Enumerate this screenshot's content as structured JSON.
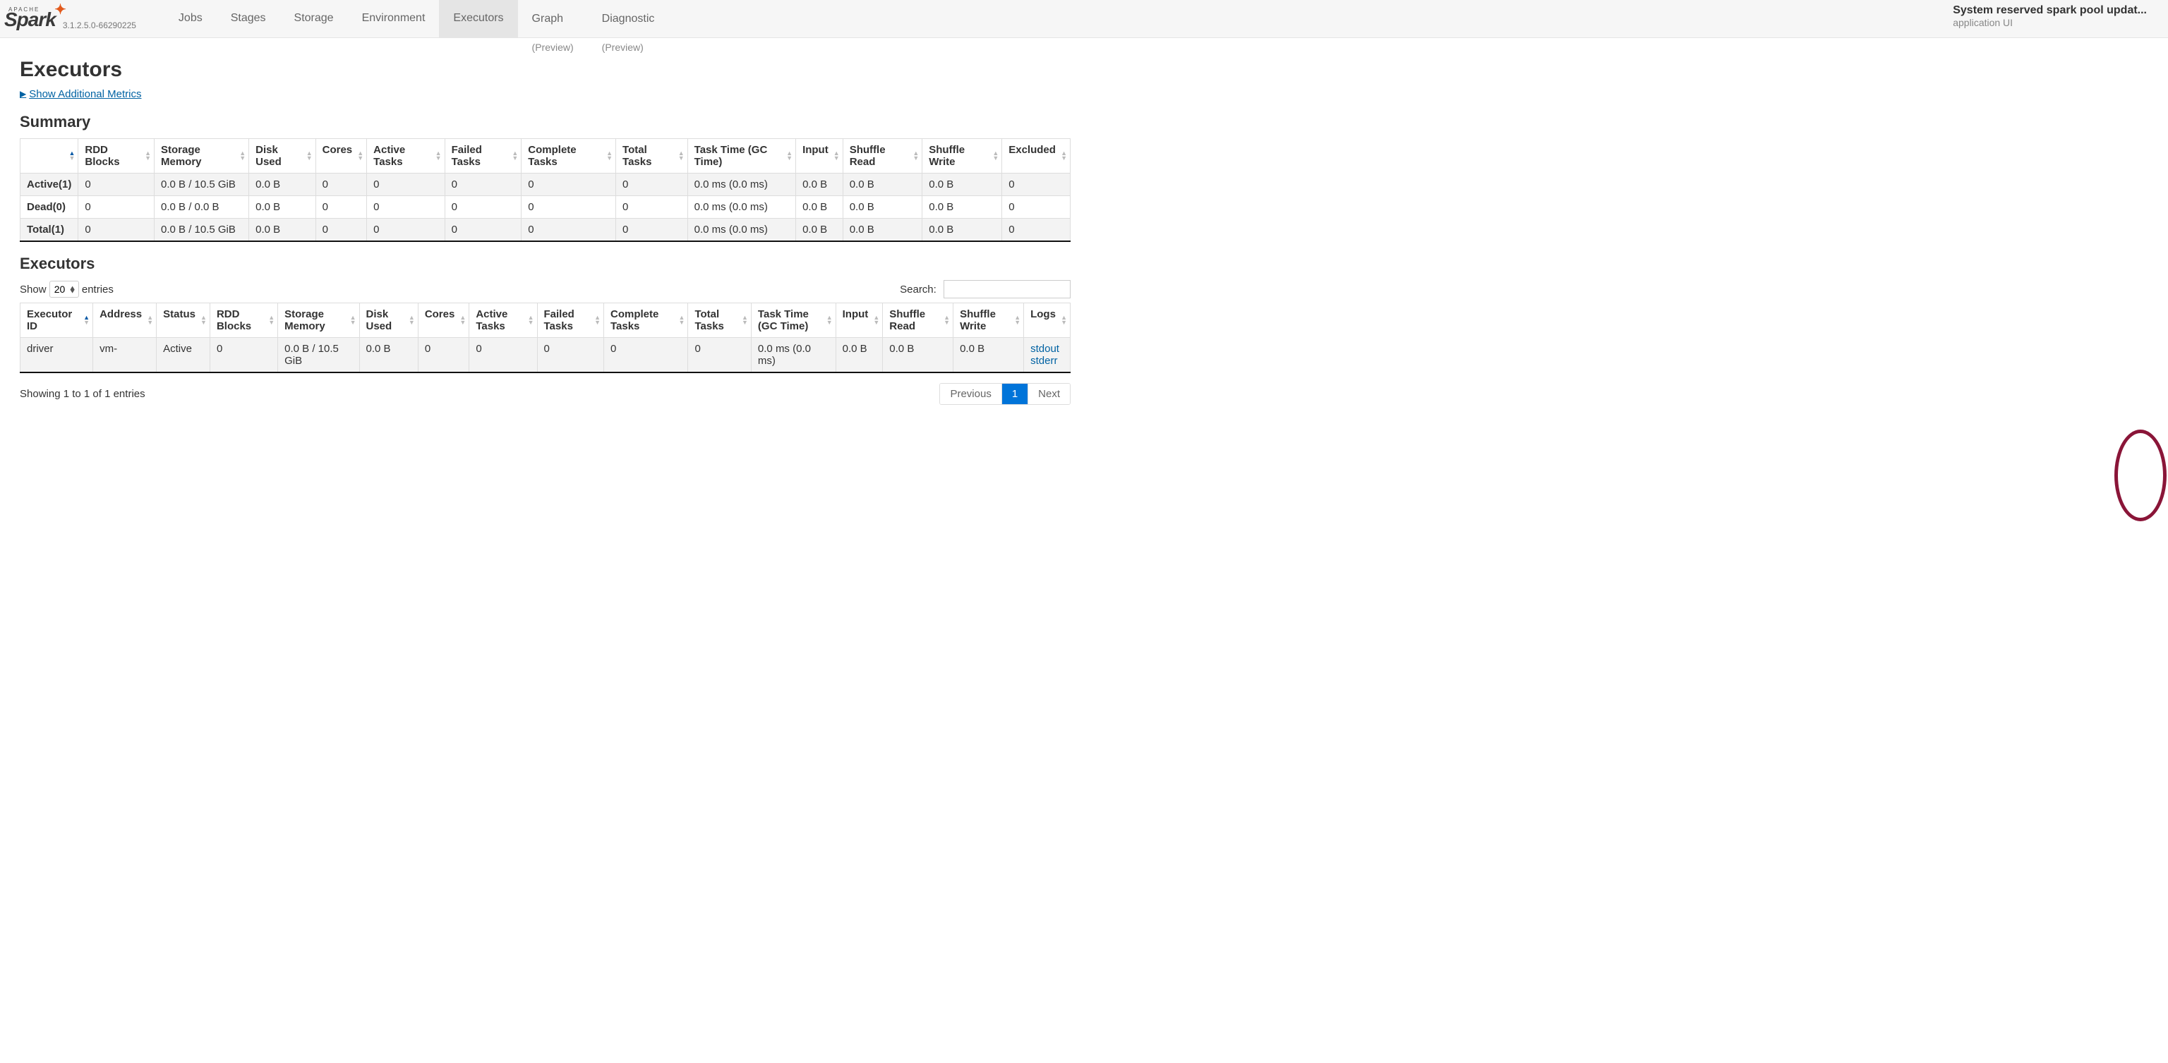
{
  "brand": {
    "small": "APACHE",
    "name": "Spark",
    "version": "3.1.2.5.0-66290225",
    "tm": "™"
  },
  "nav": {
    "tabs": [
      {
        "label": "Jobs",
        "active": false
      },
      {
        "label": "Stages",
        "active": false
      },
      {
        "label": "Storage",
        "active": false
      },
      {
        "label": "Environment",
        "active": false
      },
      {
        "label": "Executors",
        "active": true
      },
      {
        "label": "Graph",
        "preview": "(Preview)",
        "active": false
      },
      {
        "label": "Diagnostic",
        "preview": "(Preview)",
        "active": false
      }
    ]
  },
  "app": {
    "title": "System reserved spark pool updat...",
    "sub": "application UI"
  },
  "page_title": "Executors",
  "metrics_toggle": "Show Additional Metrics",
  "sections": {
    "summary": "Summary",
    "executors": "Executors"
  },
  "summary_table": {
    "headers": [
      "",
      "RDD Blocks",
      "Storage Memory",
      "Disk Used",
      "Cores",
      "Active Tasks",
      "Failed Tasks",
      "Complete Tasks",
      "Total Tasks",
      "Task Time (GC Time)",
      "Input",
      "Shuffle Read",
      "Shuffle Write",
      "Excluded"
    ],
    "rows": [
      [
        "Active(1)",
        "0",
        "0.0 B / 10.5 GiB",
        "0.0 B",
        "0",
        "0",
        "0",
        "0",
        "0",
        "0.0 ms (0.0 ms)",
        "0.0 B",
        "0.0 B",
        "0.0 B",
        "0"
      ],
      [
        "Dead(0)",
        "0",
        "0.0 B / 0.0 B",
        "0.0 B",
        "0",
        "0",
        "0",
        "0",
        "0",
        "0.0 ms (0.0 ms)",
        "0.0 B",
        "0.0 B",
        "0.0 B",
        "0"
      ],
      [
        "Total(1)",
        "0",
        "0.0 B / 10.5 GiB",
        "0.0 B",
        "0",
        "0",
        "0",
        "0",
        "0",
        "0.0 ms (0.0 ms)",
        "0.0 B",
        "0.0 B",
        "0.0 B",
        "0"
      ]
    ]
  },
  "dt": {
    "show": "Show",
    "entries": "entries",
    "length_value": "20",
    "search": "Search:",
    "info": "Showing 1 to 1 of 1 entries",
    "prev": "Previous",
    "next": "Next",
    "page": "1"
  },
  "exec_table": {
    "headers": [
      "Executor ID",
      "Address",
      "Status",
      "RDD Blocks",
      "Storage Memory",
      "Disk Used",
      "Cores",
      "Active Tasks",
      "Failed Tasks",
      "Complete Tasks",
      "Total Tasks",
      "Task Time (GC Time)",
      "Input",
      "Shuffle Read",
      "Shuffle Write",
      "Logs"
    ],
    "rows": [
      {
        "cells": [
          "driver",
          "vm-",
          "Active",
          "0",
          "0.0 B / 10.5 GiB",
          "0.0 B",
          "0",
          "0",
          "0",
          "0",
          "0",
          "0.0 ms (0.0 ms)",
          "0.0 B",
          "0.0 B",
          "0.0 B"
        ],
        "logs": [
          "stdout",
          "stderr"
        ]
      }
    ]
  }
}
